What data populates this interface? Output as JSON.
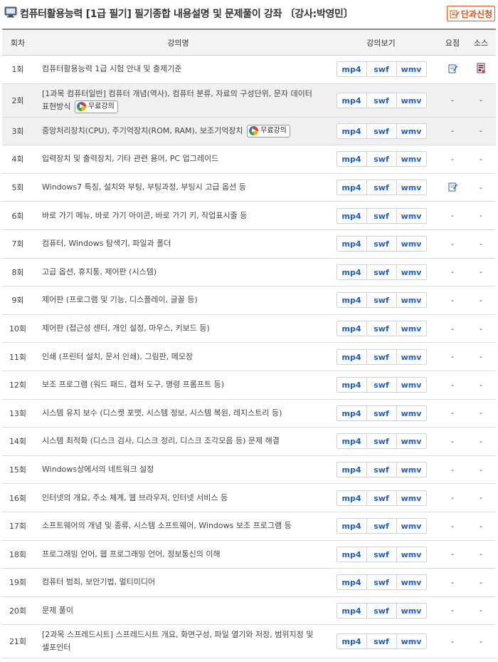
{
  "header": {
    "title": "컴퓨터활용능력 [1급 필기] 필기종합 내용설명 및 문제풀이 강좌 〔강사:박영민〕",
    "enroll_label": "단과신청"
  },
  "columns": {
    "no": "회차",
    "title": "강의명",
    "views": "강의보기",
    "summary": "요점",
    "source": "소스"
  },
  "formats": [
    "mp4",
    "swf",
    "wmv"
  ],
  "free_label": "무료강의",
  "dash": "-",
  "lectures": [
    {
      "no": "1회",
      "title": "컴퓨터활용능력 1급 시험 안내 및 출제기준"
    },
    {
      "no": "2회",
      "title": "[1과목 컴퓨터일반] 컴퓨터 개념(역사), 컴퓨터 분류, 자료의 구성단위, 문자 데이터 표현방식"
    },
    {
      "no": "3회",
      "title": "중앙처리장치(CPU), 주기억장치(ROM, RAM), 보조기억장치"
    },
    {
      "no": "4회",
      "title": "입력장치 및 출력장치, 기타 관련 용어, PC 업그레이드"
    },
    {
      "no": "5회",
      "title": "Windows7 특징, 설치와 부팅, 부팅과정, 부팅시 고급 옵션 등"
    },
    {
      "no": "6회",
      "title": "바로 가기 메뉴, 바로 가기 아이콘, 바로 가기 키, 작업표시줄 등"
    },
    {
      "no": "7회",
      "title": "컴퓨터, Windows 탐색기, 파일과 폴더"
    },
    {
      "no": "8회",
      "title": "고급 옵션, 휴지통, 제어판 (시스템)"
    },
    {
      "no": "9회",
      "title": "제어판 (프로그램 및 기능, 디스플레이, 글꼴 등)"
    },
    {
      "no": "10회",
      "title": "제어판 (접근성 센터, 개인 설정, 마우스, 키보드 등)"
    },
    {
      "no": "11회",
      "title": "인쇄 (프린터 설치, 문서 인쇄), 그림판, 메모장"
    },
    {
      "no": "12회",
      "title": "보조 프로그램 (워드 패드, 캡처 도구, 명령 프롬프트 등)"
    },
    {
      "no": "13회",
      "title": "시스템 유지 보수 (디스켓 포맷, 시스템 정보, 시스템 복원, 레지스트리 등)"
    },
    {
      "no": "14회",
      "title": "시스템 최적화 (디스크 검사, 디스크 정리, 디스크 조각모음 등) 문제 해결"
    },
    {
      "no": "15회",
      "title": "Windows상에서의 네트워크 설정"
    },
    {
      "no": "16회",
      "title": "인터넷의 개요, 주소 체계, 웹 브라우저, 인터넷 서비스 등"
    },
    {
      "no": "17회",
      "title": "소프트웨어의 개념 및 종류, 시스템 소프트웨어, Windows 보조 프로그램 등"
    },
    {
      "no": "18회",
      "title": "프로그래밍 언어, 웹 프로그래밍 언어, 정보통신의 이해"
    },
    {
      "no": "19회",
      "title": "컴퓨터 범죄, 보안기법, 멀티미디어"
    },
    {
      "no": "20회",
      "title": "문제 풀이"
    },
    {
      "no": "21회",
      "title": "[2과목 스프레드시트] 스프레드시트 개요, 화면구성, 파일 열기와 저장, 범위지정 및 셀포인터"
    }
  ]
}
